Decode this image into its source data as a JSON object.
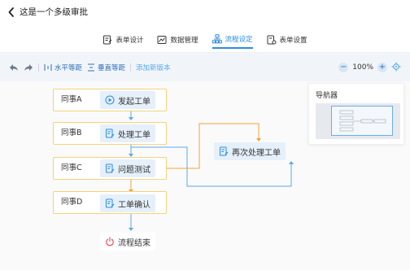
{
  "header": {
    "title": "这是一个多级审批",
    "tabs": [
      {
        "label": "表单设计",
        "icon": "form-design-icon",
        "active": false
      },
      {
        "label": "数据管理",
        "icon": "data-manage-icon",
        "active": false
      },
      {
        "label": "流程设定",
        "icon": "flow-setting-icon",
        "active": true
      },
      {
        "label": "表单设置",
        "icon": "form-setting-icon",
        "active": false
      }
    ]
  },
  "toolbar": {
    "undo_icon": "undo-icon",
    "redo_icon": "redo-icon",
    "horizontal_spacing": "水平等距",
    "vertical_spacing": "垂直等距",
    "add_version": "添加新版本",
    "zoom": "100%"
  },
  "navigator": {
    "title": "导航器"
  },
  "flow": {
    "lanes": [
      {
        "label": "同事A",
        "node": "发起工单",
        "node_icon": "play-circle-icon"
      },
      {
        "label": "同事B",
        "node": "处理工单",
        "node_icon": "document-edit-icon"
      },
      {
        "label": "同事C",
        "node": "问题测试",
        "node_icon": "document-edit-icon"
      },
      {
        "label": "同事D",
        "node": "工单确认",
        "node_icon": "document-edit-icon"
      }
    ],
    "side_node": {
      "label": "再次处理工单",
      "icon": "document-edit-icon"
    },
    "end_node": {
      "label": "流程结束",
      "icon": "power-icon"
    }
  },
  "colors": {
    "accent": "#2b8ce0",
    "lane_border": "#f3d37a",
    "node_bg": "#e6f0fa",
    "edge_blue": "#5aa9ec",
    "edge_orange": "#f0a43a",
    "end_red": "#e8535a"
  }
}
